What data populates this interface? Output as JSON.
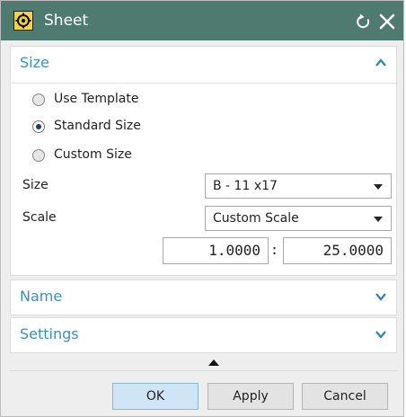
{
  "dialog": {
    "title": "Sheet"
  },
  "sections": {
    "size": {
      "header": "Size",
      "options": [
        {
          "label": "Use Template",
          "checked": false
        },
        {
          "label": "Standard Size",
          "checked": true
        },
        {
          "label": "Custom Size",
          "checked": false
        }
      ],
      "size_label": "Size",
      "size_value": "B - 11 x17",
      "scale_label": "Scale",
      "scale_value": "Custom Scale",
      "scale_numerator": "1.0000",
      "scale_separator": ":",
      "scale_denominator": "25.0000"
    },
    "name": {
      "header": "Name"
    },
    "settings": {
      "header": "Settings"
    }
  },
  "buttons": {
    "ok": "OK",
    "apply": "Apply",
    "cancel": "Cancel"
  },
  "colors": {
    "titlebar": "#4e7a6f",
    "section_header": "#3a8fbf",
    "ok_button": "#cfe4f4"
  },
  "icons": [
    "sheet-app-icon",
    "reset-icon",
    "close-icon",
    "chevron-up-icon",
    "chevron-down-icon",
    "more-options-icon"
  ]
}
